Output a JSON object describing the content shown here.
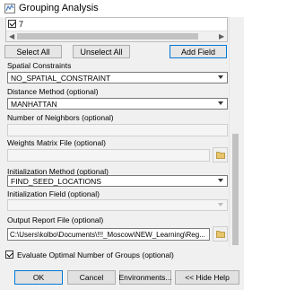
{
  "window": {
    "title": "Grouping Analysis",
    "icon": "grouping-tool-icon"
  },
  "fields_list": {
    "items": [
      {
        "label": "7",
        "checked": true
      }
    ]
  },
  "field_buttons": {
    "select_all": "Select All",
    "unselect_all": "Unselect All",
    "add_field": "Add Field"
  },
  "spatial_constraints": {
    "label": "Spatial Constraints",
    "value": "NO_SPATIAL_CONSTRAINT"
  },
  "distance_method": {
    "label": "Distance Method (optional)",
    "value": "MANHATTAN"
  },
  "number_of_neighbors": {
    "label": "Number of Neighbors (optional)",
    "value": ""
  },
  "weights_matrix_file": {
    "label": "Weights Matrix File (optional)",
    "value": ""
  },
  "initialization_method": {
    "label": "Initialization Method (optional)",
    "value": "FIND_SEED_LOCATIONS"
  },
  "initialization_field": {
    "label": "Initialization Field (optional)",
    "value": ""
  },
  "output_report_file": {
    "label": "Output Report File (optional)",
    "value": "C:\\Users\\kolbo\\Documents\\!!!_Moscow\\NEW_Learning\\Reg..."
  },
  "evaluate_optimal": {
    "label": "Evaluate Optimal Number of Groups (optional)",
    "checked": true
  },
  "dialog_buttons": {
    "ok": "OK",
    "cancel": "Cancel",
    "environments": "Environments...",
    "hide_help": "<< Hide Help"
  }
}
